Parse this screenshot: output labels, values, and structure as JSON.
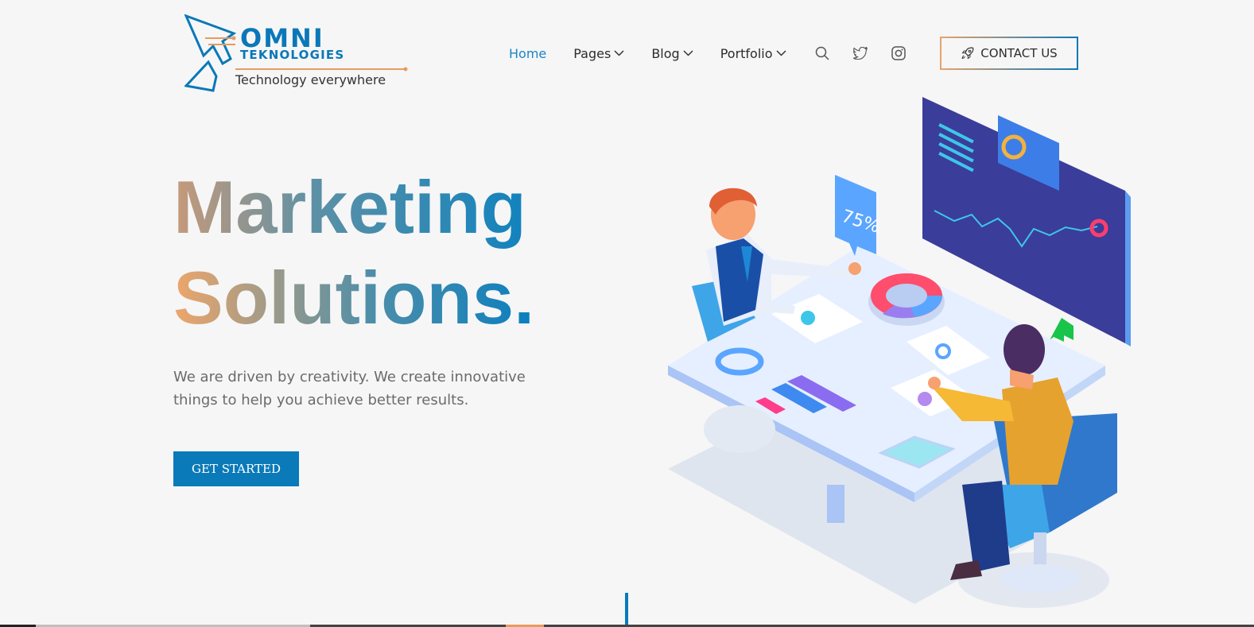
{
  "logo": {
    "word": "OMNI",
    "word2": "TEKNOLOGIES",
    "tagline": "Technology everywhere"
  },
  "nav": {
    "items": [
      {
        "label": "Home",
        "active": true,
        "dropdown": false
      },
      {
        "label": "Pages",
        "active": false,
        "dropdown": true
      },
      {
        "label": "Blog",
        "active": false,
        "dropdown": true
      },
      {
        "label": "Portfolio",
        "active": false,
        "dropdown": true
      }
    ],
    "icons": [
      "search-icon",
      "twitter-icon",
      "instagram-icon"
    ],
    "contact_label": "CONTACT US",
    "contact_icon": "rocket-icon"
  },
  "hero": {
    "title_line1": "Marketing",
    "title_line2": "Solutions.",
    "subtitle": "We are driven by creativity. We create innovative things to help you achieve better results.",
    "cta_label": "GET STARTED"
  },
  "illustration": {
    "badge_text": "75%"
  },
  "colors": {
    "accent": "#0a7ab9",
    "nav_active": "#1a86c4",
    "gradient_warm": "#eea66a",
    "background": "#f6f6f7"
  }
}
